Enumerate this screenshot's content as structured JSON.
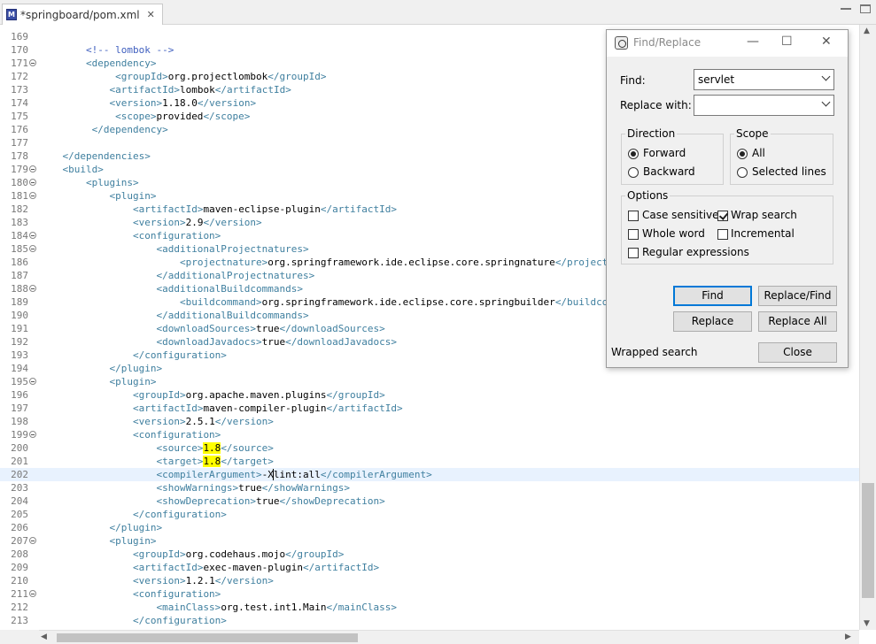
{
  "tab": {
    "title": "*springboard/pom.xml",
    "icon": "xml-file-icon"
  },
  "editor": {
    "lines": [
      {
        "n": "169",
        "fold": false,
        "segs": []
      },
      {
        "n": "170",
        "fold": false,
        "segs": [
          {
            "t": "        "
          },
          {
            "t": "<!-- lombok -->",
            "c": "cmt"
          }
        ]
      },
      {
        "n": "171",
        "fold": true,
        "segs": [
          {
            "t": "        "
          },
          {
            "t": "<dependency>",
            "c": "tag"
          }
        ]
      },
      {
        "n": "172",
        "fold": false,
        "segs": [
          {
            "t": "             "
          },
          {
            "t": "<groupId>",
            "c": "tag"
          },
          {
            "t": "org.projectlombok"
          },
          {
            "t": "</groupId>",
            "c": "tag"
          }
        ]
      },
      {
        "n": "173",
        "fold": false,
        "segs": [
          {
            "t": "            "
          },
          {
            "t": "<artifactId>",
            "c": "tag"
          },
          {
            "t": "lombok"
          },
          {
            "t": "</artifactId>",
            "c": "tag"
          }
        ]
      },
      {
        "n": "174",
        "fold": false,
        "segs": [
          {
            "t": "            "
          },
          {
            "t": "<version>",
            "c": "tag"
          },
          {
            "t": "1.18.0"
          },
          {
            "t": "</version>",
            "c": "tag"
          }
        ]
      },
      {
        "n": "175",
        "fold": false,
        "segs": [
          {
            "t": "             "
          },
          {
            "t": "<scope>",
            "c": "tag"
          },
          {
            "t": "provided"
          },
          {
            "t": "</scope>",
            "c": "tag"
          }
        ]
      },
      {
        "n": "176",
        "fold": false,
        "segs": [
          {
            "t": "         "
          },
          {
            "t": "</dependency>",
            "c": "tag"
          }
        ]
      },
      {
        "n": "177",
        "fold": false,
        "segs": []
      },
      {
        "n": "178",
        "fold": false,
        "segs": [
          {
            "t": "    "
          },
          {
            "t": "</dependencies>",
            "c": "tag"
          }
        ]
      },
      {
        "n": "179",
        "fold": true,
        "segs": [
          {
            "t": "    "
          },
          {
            "t": "<build>",
            "c": "tag"
          }
        ]
      },
      {
        "n": "180",
        "fold": true,
        "segs": [
          {
            "t": "        "
          },
          {
            "t": "<plugins>",
            "c": "tag"
          }
        ]
      },
      {
        "n": "181",
        "fold": true,
        "segs": [
          {
            "t": "            "
          },
          {
            "t": "<plugin>",
            "c": "tag"
          }
        ]
      },
      {
        "n": "182",
        "fold": false,
        "segs": [
          {
            "t": "                "
          },
          {
            "t": "<artifactId>",
            "c": "tag"
          },
          {
            "t": "maven-eclipse-plugin"
          },
          {
            "t": "</artifactId>",
            "c": "tag"
          }
        ]
      },
      {
        "n": "183",
        "fold": false,
        "segs": [
          {
            "t": "                "
          },
          {
            "t": "<version>",
            "c": "tag"
          },
          {
            "t": "2.9"
          },
          {
            "t": "</version>",
            "c": "tag"
          }
        ]
      },
      {
        "n": "184",
        "fold": true,
        "segs": [
          {
            "t": "                "
          },
          {
            "t": "<configuration>",
            "c": "tag"
          }
        ]
      },
      {
        "n": "185",
        "fold": true,
        "segs": [
          {
            "t": "                    "
          },
          {
            "t": "<additionalProjectnatures>",
            "c": "tag"
          }
        ]
      },
      {
        "n": "186",
        "fold": false,
        "segs": [
          {
            "t": "                        "
          },
          {
            "t": "<projectnature>",
            "c": "tag"
          },
          {
            "t": "org.springframework.ide.eclipse.core.springnature"
          },
          {
            "t": "</projectnature>",
            "c": "tag"
          }
        ]
      },
      {
        "n": "187",
        "fold": false,
        "segs": [
          {
            "t": "                    "
          },
          {
            "t": "</additionalProjectnatures>",
            "c": "tag"
          }
        ]
      },
      {
        "n": "188",
        "fold": true,
        "segs": [
          {
            "t": "                    "
          },
          {
            "t": "<additionalBuildcommands>",
            "c": "tag"
          }
        ]
      },
      {
        "n": "189",
        "fold": false,
        "segs": [
          {
            "t": "                        "
          },
          {
            "t": "<buildcommand>",
            "c": "tag"
          },
          {
            "t": "org.springframework.ide.eclipse.core.springbuilder"
          },
          {
            "t": "</buildcommand>",
            "c": "tag"
          }
        ]
      },
      {
        "n": "190",
        "fold": false,
        "segs": [
          {
            "t": "                    "
          },
          {
            "t": "</additionalBuildcommands>",
            "c": "tag"
          }
        ]
      },
      {
        "n": "191",
        "fold": false,
        "segs": [
          {
            "t": "                    "
          },
          {
            "t": "<downloadSources>",
            "c": "tag"
          },
          {
            "t": "true"
          },
          {
            "t": "</downloadSources>",
            "c": "tag"
          }
        ]
      },
      {
        "n": "192",
        "fold": false,
        "segs": [
          {
            "t": "                    "
          },
          {
            "t": "<downloadJavadocs>",
            "c": "tag"
          },
          {
            "t": "true"
          },
          {
            "t": "</downloadJavadocs>",
            "c": "tag"
          }
        ]
      },
      {
        "n": "193",
        "fold": false,
        "segs": [
          {
            "t": "                "
          },
          {
            "t": "</configuration>",
            "c": "tag"
          }
        ]
      },
      {
        "n": "194",
        "fold": false,
        "segs": [
          {
            "t": "            "
          },
          {
            "t": "</plugin>",
            "c": "tag"
          }
        ]
      },
      {
        "n": "195",
        "fold": true,
        "segs": [
          {
            "t": "            "
          },
          {
            "t": "<plugin>",
            "c": "tag"
          }
        ]
      },
      {
        "n": "196",
        "fold": false,
        "segs": [
          {
            "t": "                "
          },
          {
            "t": "<groupId>",
            "c": "tag"
          },
          {
            "t": "org.apache.maven.plugins"
          },
          {
            "t": "</groupId>",
            "c": "tag"
          }
        ]
      },
      {
        "n": "197",
        "fold": false,
        "segs": [
          {
            "t": "                "
          },
          {
            "t": "<artifactId>",
            "c": "tag"
          },
          {
            "t": "maven-compiler-plugin"
          },
          {
            "t": "</artifactId>",
            "c": "tag"
          }
        ]
      },
      {
        "n": "198",
        "fold": false,
        "segs": [
          {
            "t": "                "
          },
          {
            "t": "<version>",
            "c": "tag"
          },
          {
            "t": "2.5.1"
          },
          {
            "t": "</version>",
            "c": "tag"
          }
        ]
      },
      {
        "n": "199",
        "fold": true,
        "segs": [
          {
            "t": "                "
          },
          {
            "t": "<configuration>",
            "c": "tag"
          }
        ]
      },
      {
        "n": "200",
        "fold": false,
        "segs": [
          {
            "t": "                    "
          },
          {
            "t": "<source>",
            "c": "tag"
          },
          {
            "t": "1.8",
            "c": "hl"
          },
          {
            "t": "</source>",
            "c": "tag"
          }
        ]
      },
      {
        "n": "201",
        "fold": false,
        "segs": [
          {
            "t": "                    "
          },
          {
            "t": "<target>",
            "c": "tag"
          },
          {
            "t": "1.8",
            "c": "hl"
          },
          {
            "t": "</target>",
            "c": "tag"
          }
        ]
      },
      {
        "n": "202",
        "fold": false,
        "current": true,
        "segs": [
          {
            "t": "                    "
          },
          {
            "t": "<compilerArgument>",
            "c": "tag"
          },
          {
            "t": "-X"
          },
          {
            "t": "lint:all",
            "c": "caret"
          },
          {
            "t": "</compilerArgument>",
            "c": "tag"
          }
        ]
      },
      {
        "n": "203",
        "fold": false,
        "segs": [
          {
            "t": "                    "
          },
          {
            "t": "<showWarnings>",
            "c": "tag"
          },
          {
            "t": "true"
          },
          {
            "t": "</showWarnings>",
            "c": "tag"
          }
        ]
      },
      {
        "n": "204",
        "fold": false,
        "segs": [
          {
            "t": "                    "
          },
          {
            "t": "<showDeprecation>",
            "c": "tag"
          },
          {
            "t": "true"
          },
          {
            "t": "</showDeprecation>",
            "c": "tag"
          }
        ]
      },
      {
        "n": "205",
        "fold": false,
        "segs": [
          {
            "t": "                "
          },
          {
            "t": "</configuration>",
            "c": "tag"
          }
        ]
      },
      {
        "n": "206",
        "fold": false,
        "segs": [
          {
            "t": "            "
          },
          {
            "t": "</plugin>",
            "c": "tag"
          }
        ]
      },
      {
        "n": "207",
        "fold": true,
        "segs": [
          {
            "t": "            "
          },
          {
            "t": "<plugin>",
            "c": "tag"
          }
        ]
      },
      {
        "n": "208",
        "fold": false,
        "segs": [
          {
            "t": "                "
          },
          {
            "t": "<groupId>",
            "c": "tag"
          },
          {
            "t": "org.codehaus.mojo"
          },
          {
            "t": "</groupId>",
            "c": "tag"
          }
        ]
      },
      {
        "n": "209",
        "fold": false,
        "segs": [
          {
            "t": "                "
          },
          {
            "t": "<artifactId>",
            "c": "tag"
          },
          {
            "t": "exec-maven-plugin"
          },
          {
            "t": "</artifactId>",
            "c": "tag"
          }
        ]
      },
      {
        "n": "210",
        "fold": false,
        "segs": [
          {
            "t": "                "
          },
          {
            "t": "<version>",
            "c": "tag"
          },
          {
            "t": "1.2.1"
          },
          {
            "t": "</version>",
            "c": "tag"
          }
        ]
      },
      {
        "n": "211",
        "fold": true,
        "segs": [
          {
            "t": "                "
          },
          {
            "t": "<configuration>",
            "c": "tag"
          }
        ]
      },
      {
        "n": "212",
        "fold": false,
        "segs": [
          {
            "t": "                    "
          },
          {
            "t": "<mainClass>",
            "c": "tag"
          },
          {
            "t": "org.test.int1.Main"
          },
          {
            "t": "</mainClass>",
            "c": "tag"
          }
        ]
      },
      {
        "n": "213",
        "fold": false,
        "segs": [
          {
            "t": "                "
          },
          {
            "t": "</configuration>",
            "c": "tag"
          }
        ]
      }
    ]
  },
  "dialog": {
    "title": "Find/Replace",
    "find_label": "Find:",
    "find_value": "servlet",
    "replace_label": "Replace with:",
    "replace_value": "",
    "direction": {
      "title": "Direction",
      "forward": "Forward",
      "backward": "Backward",
      "selected": "forward"
    },
    "scope": {
      "title": "Scope",
      "all": "All",
      "selected_lines": "Selected lines",
      "selected": "all"
    },
    "options": {
      "title": "Options",
      "case_sensitive": {
        "label": "Case sensitive",
        "checked": false
      },
      "wrap_search": {
        "label": "Wrap search",
        "checked": true
      },
      "whole_word": {
        "label": "Whole word",
        "checked": false
      },
      "incremental": {
        "label": "Incremental",
        "checked": false
      },
      "regex": {
        "label": "Regular expressions",
        "checked": false
      }
    },
    "buttons": {
      "find": "Find",
      "replace_find": "Replace/Find",
      "replace": "Replace",
      "replace_all": "Replace All",
      "close": "Close"
    },
    "status": "Wrapped search"
  },
  "colors": {
    "tag": "#3f7f9f",
    "comment": "#3f5fbf",
    "highlight": "#ffff00",
    "current_line": "#e8f2fe"
  }
}
